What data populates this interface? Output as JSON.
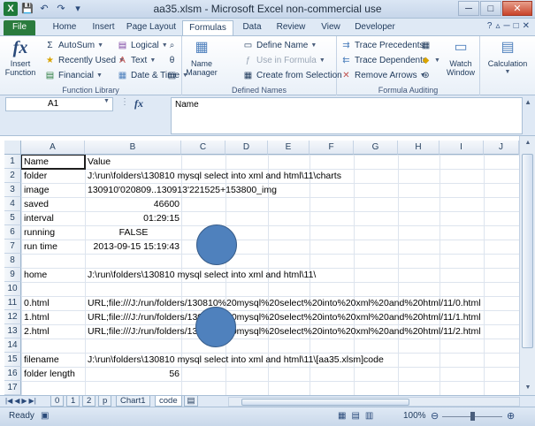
{
  "window": {
    "title": "aa35.xlsm - Microsoft Excel non-commercial use",
    "controls": {
      "minimize": "─",
      "maximize": "□",
      "close": "✕"
    }
  },
  "qat": {
    "save": "💾",
    "undo": "↶",
    "redo": "↷",
    "customize": "▾"
  },
  "tabs": {
    "file": "File",
    "home": "Home",
    "insert": "Insert",
    "page_layout": "Page Layout",
    "formulas": "Formulas",
    "data": "Data",
    "review": "Review",
    "view": "View",
    "developer": "Developer"
  },
  "ribbon": {
    "insert_function": {
      "label": "Insert Function",
      "label1": "Insert",
      "label2": "Function",
      "icon": "fx-icon"
    },
    "function_library": {
      "title": "Function Library",
      "autosum": "AutoSum",
      "recently_used": "Recently Used",
      "financial": "Financial",
      "logical": "Logical",
      "text": "Text",
      "date_time": "Date & Time"
    },
    "defined_names": {
      "title": "Defined Names",
      "name_manager_1": "Name",
      "name_manager_2": "Manager",
      "define_name": "Define Name",
      "use_in_formula": "Use in Formula",
      "create_from_selection": "Create from Selection"
    },
    "formula_auditing": {
      "title": "Formula Auditing",
      "trace_precedents": "Trace Precedents",
      "trace_dependents": "Trace Dependents",
      "remove_arrows": "Remove Arrows",
      "watch_window_1": "Watch",
      "watch_window_2": "Window"
    },
    "calculation": {
      "label": "Calculation"
    }
  },
  "formula_bar": {
    "name_box": "A1",
    "fx": "fx",
    "content": "Name"
  },
  "columns": [
    "A",
    "B",
    "C",
    "D",
    "E",
    "F",
    "G",
    "H",
    "I",
    "J"
  ],
  "rows": [
    "1",
    "2",
    "3",
    "4",
    "5",
    "6",
    "7",
    "8",
    "9",
    "10",
    "11",
    "12",
    "13",
    "14",
    "15",
    "16",
    "17"
  ],
  "cells": {
    "r1": {
      "a": "Name",
      "b": "Value"
    },
    "r2": {
      "a": "folder",
      "b": "J:\\run\\folders\\130810 mysql select into xml and html\\11\\charts"
    },
    "r3": {
      "a": "image",
      "b": "130910'020809..130913'221525+153800_img"
    },
    "r4": {
      "a": "saved",
      "b": "46600"
    },
    "r5": {
      "a": "interval",
      "b": "01:29:15"
    },
    "r6": {
      "a": "running",
      "b": "FALSE"
    },
    "r7": {
      "a": "run time",
      "b": "2013-09-15 15:19:43"
    },
    "r9": {
      "a": "home",
      "b": "J:\\run\\folders\\130810 mysql select into xml and html\\11\\"
    },
    "r11": {
      "a": "0.html",
      "b": "URL;file:///J:/run/folders/130810%20mysql%20select%20into%20xml%20and%20html/11/0.html"
    },
    "r12": {
      "a": "1.html",
      "b": "URL;file:///J:/run/folders/130810%20mysql%20select%20into%20xml%20and%20html/11/1.html"
    },
    "r13": {
      "a": "2.html",
      "b": "URL;file:///J:/run/folders/130810%20mysql%20select%20into%20xml%20and%20html/11/2.html"
    },
    "r15": {
      "a": "filename",
      "b": "J:\\run\\folders\\130810 mysql select into xml and html\\11\\[aa35.xlsm]code"
    },
    "r16": {
      "a": "folder length",
      "b": "56"
    }
  },
  "sheets": [
    "0",
    "1",
    "2",
    "p",
    "Chart1",
    "code"
  ],
  "active_sheet": "code",
  "status": {
    "ready": "Ready",
    "zoom": "100%"
  },
  "colors": {
    "file_tab": "#2a7b3d",
    "circle": "#4f81bd",
    "ribbon_bg": "#dfe9f5"
  }
}
